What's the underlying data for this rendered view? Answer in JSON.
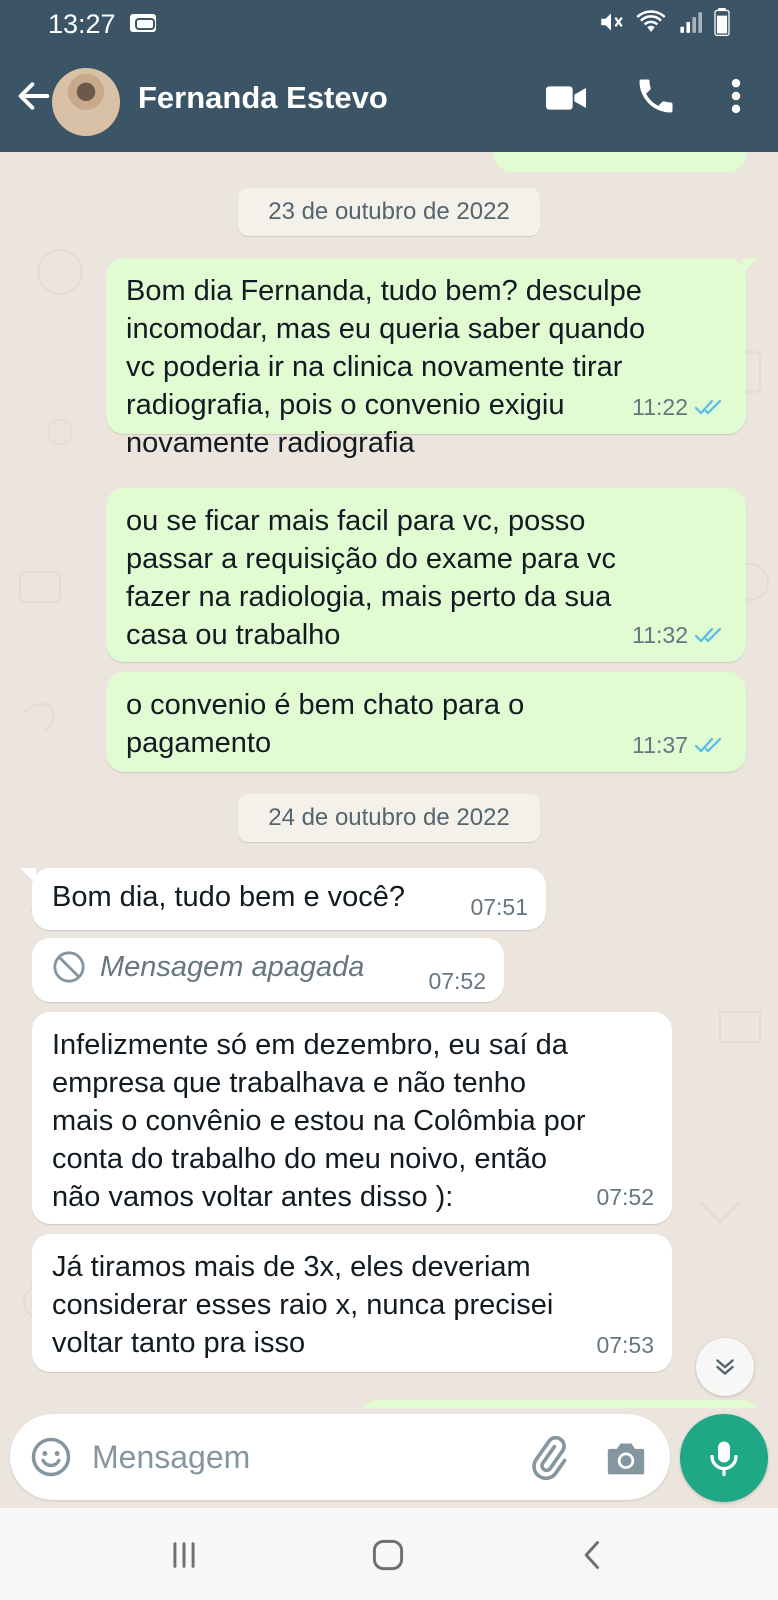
{
  "status_bar": {
    "time": "13:27",
    "icons": [
      "voicemail-icon",
      "mute-icon",
      "wifi-icon",
      "signal-icon",
      "battery-icon"
    ]
  },
  "header": {
    "contact_name": "Fernanda Estevo",
    "actions": [
      "video-call-icon",
      "voice-call-icon",
      "more-options-icon"
    ],
    "color": "#3b5566"
  },
  "chat": {
    "date_separators": [
      "23 de outubro de 2022",
      "24 de outubro de 2022"
    ],
    "messages": [
      {
        "direction": "outgoing",
        "text": "Bom dia Fernanda, tudo bem?  desculpe\nincomodar, mas eu queria saber quando\nvc poderia ir na clinica novamente tirar\nradiografia, pois o convenio exigiu\nnovamente radiografia",
        "time": "11:22",
        "status": "read"
      },
      {
        "direction": "outgoing",
        "text": "ou se ficar mais facil para vc, posso\npassar a requisição do exame para vc\nfazer na radiologia, mais perto da sua\ncasa ou trabalho",
        "time": "11:32",
        "status": "read"
      },
      {
        "direction": "outgoing",
        "text": "o convenio é bem chato para o\npagamento",
        "time": "11:37",
        "status": "read"
      },
      {
        "direction": "incoming",
        "text": "Bom dia, tudo bem e você?",
        "time": "07:51"
      },
      {
        "direction": "incoming",
        "text": "Mensagem apagada",
        "time": "07:52",
        "deleted": true
      },
      {
        "direction": "incoming",
        "text": "Infelizmente só em dezembro, eu saí da\nempresa que trabalhava e não tenho\nmais o convênio e estou na Colômbia por\nconta do trabalho do meu noivo, então\nnão vamos voltar antes disso ):",
        "time": "07:52"
      },
      {
        "direction": "incoming",
        "text": "Já tiramos mais de 3x, eles deveriam\nconsiderar esses raio x, nunca precisei\nvoltar tanto pra isso",
        "time": "07:53"
      }
    ],
    "colors": {
      "outgoing_bubble": "#e1fbd2",
      "incoming_bubble": "#ffffff",
      "read_ticks": "#53bdeb",
      "wallpaper": "#ece5dd"
    }
  },
  "composer": {
    "placeholder": "Mensagem",
    "value": "",
    "icons": [
      "emoji-icon",
      "attach-icon",
      "camera-icon",
      "mic-icon"
    ],
    "mic_color": "#1fa885"
  },
  "nav_bar": {
    "icons": [
      "recent-apps-icon",
      "home-icon",
      "back-icon"
    ]
  }
}
